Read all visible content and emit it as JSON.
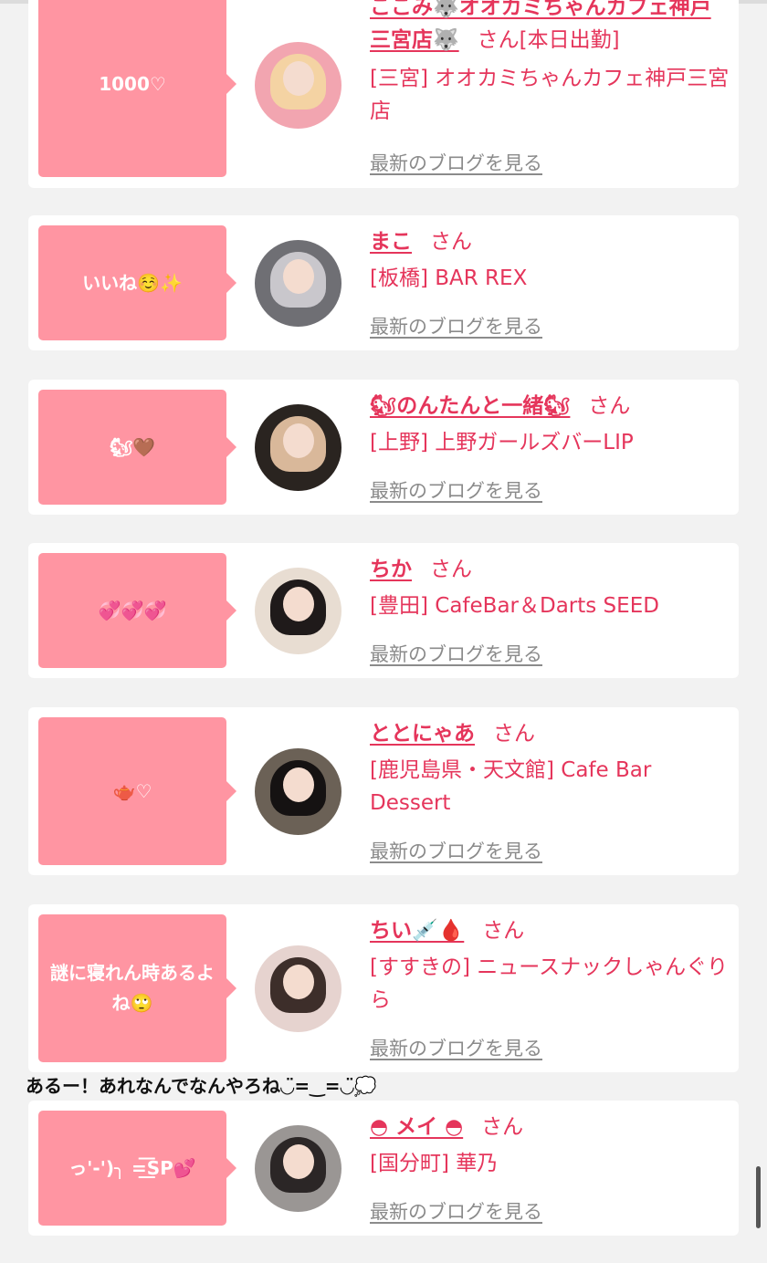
{
  "colors": {
    "accent": "#e5355b",
    "bubble": "#ff95a2",
    "background": "#f2f2f2",
    "link_gray": "#8b8b8b"
  },
  "blog_link_label": "最新のブログを見る",
  "honorific": "さん",
  "cards": [
    {
      "bubble_text": "1000♡",
      "name": "ここみ🐺オオカミちゃんカフェ神戸三宮店🐺",
      "status": "[本日出勤]",
      "shop": "[三宮] オオカミちゃんカフェ神戸三宮店",
      "blog_label": "最新のブログを見る",
      "avatar_colors": [
        "#f2a5b0",
        "#f4d3a3"
      ]
    },
    {
      "bubble_text": "いいね☺️✨",
      "name": "まこ",
      "status": "",
      "shop": "[板橋] BAR REX",
      "blog_label": "最新のブログを見る",
      "avatar_colors": [
        "#6f6f74",
        "#c9c7cc"
      ]
    },
    {
      "bubble_text": "🐿🤎",
      "name": "🐿のんたんと一緒🐿",
      "status": "",
      "shop": "[上野] 上野ガールズバーLIP",
      "blog_label": "最新のブログを見る",
      "avatar_colors": [
        "#2a2420",
        "#d9b89a"
      ]
    },
    {
      "bubble_text": "💞💞💞",
      "name": "ちか",
      "status": "",
      "shop": "[豊田] CafeBar＆Darts SEED",
      "blog_label": "最新のブログを見る",
      "avatar_colors": [
        "#e8ddd2",
        "#1f1a1a"
      ]
    },
    {
      "bubble_text": "🫖♡",
      "name": "ととにゃあ",
      "status": "",
      "shop": "[鹿児島県・天文館] Cafe Bar Dessert",
      "blog_label": "最新のブログを見る",
      "avatar_colors": [
        "#6b6156",
        "#151212"
      ]
    },
    {
      "bubble_text": "謎に寝れん時あるよね🙄",
      "name": "ちい💉🩸",
      "status": "",
      "shop": "[すすきの] ニュースナックしゃんぐりら",
      "blog_label": "最新のブログを見る",
      "avatar_colors": [
        "#e6d3cf",
        "#3d2e2a"
      ]
    },
    {
      "bubble_text": "っ'-')╮ =͟͟͞͞SP💕",
      "name": "◓ メイ ◓",
      "status": "",
      "shop": "[国分町] 華乃",
      "blog_label": "最新のブログを見る",
      "avatar_colors": [
        "#9a9694",
        "#2b2626"
      ]
    }
  ],
  "floating_comment": "あるー！あれなんでなんやろね◡̈=‿=◡̈💭"
}
